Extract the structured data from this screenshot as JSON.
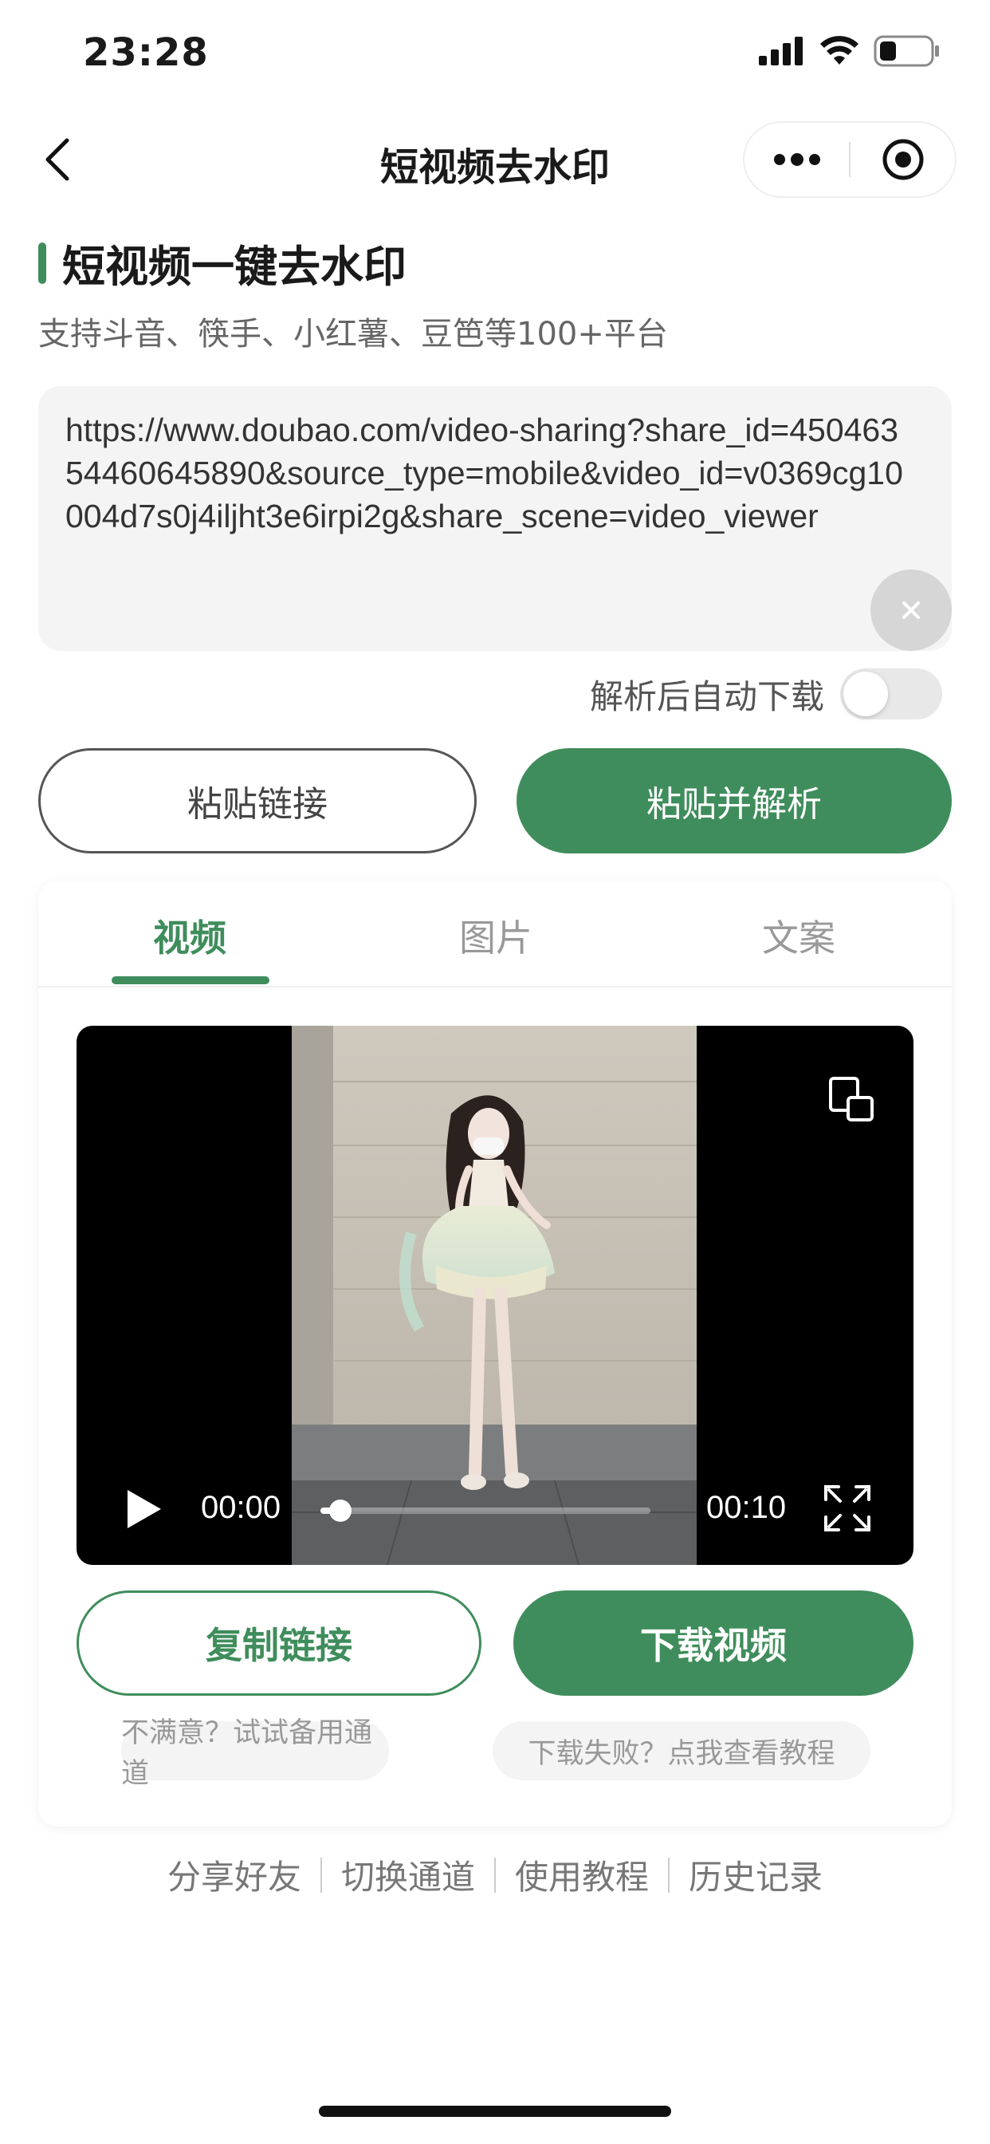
{
  "status_bar": {
    "time": "23:28",
    "icons": [
      "signal-icon",
      "wifi-icon",
      "battery-icon"
    ]
  },
  "nav": {
    "title": "短视频去水印",
    "back_icon": "chevron-left-icon",
    "more_icon": "more-dots-icon",
    "close_icon": "target-circle-icon"
  },
  "header": {
    "title": "短视频一键去水印",
    "subtitle": "支持斗音、筷手、小红薯、豆笆等100+平台"
  },
  "url_input": {
    "value": "https://www.doubao.com/video-sharing?share_id=45046354460645890&source_type=mobile&video_id=v0369cg10004d7s0j4iljht3e6irpi2g&share_scene=video_viewer",
    "clear_icon": "close-icon"
  },
  "auto_download": {
    "label": "解析后自动下载",
    "enabled": false
  },
  "actions": {
    "paste_label": "粘贴链接",
    "paste_parse_label": "粘贴并解析"
  },
  "tabs": [
    {
      "label": "视频",
      "active": true
    },
    {
      "label": "图片",
      "active": false
    },
    {
      "label": "文案",
      "active": false
    }
  ],
  "video_player": {
    "current_time": "00:00",
    "duration": "00:10",
    "progress": 0.06
  },
  "result_actions": {
    "copy_label": "复制链接",
    "download_label": "下载视频"
  },
  "hints": {
    "backup_channel": "不满意？试试备用通道",
    "tutorial": "下载失败？点我查看教程"
  },
  "footer": {
    "links": [
      "分享好友",
      "切换通道",
      "使用教程",
      "历史记录"
    ]
  },
  "colors": {
    "accent": "#3f8d5c",
    "background": "#ffffff",
    "input_bg": "#f4f4f4"
  }
}
